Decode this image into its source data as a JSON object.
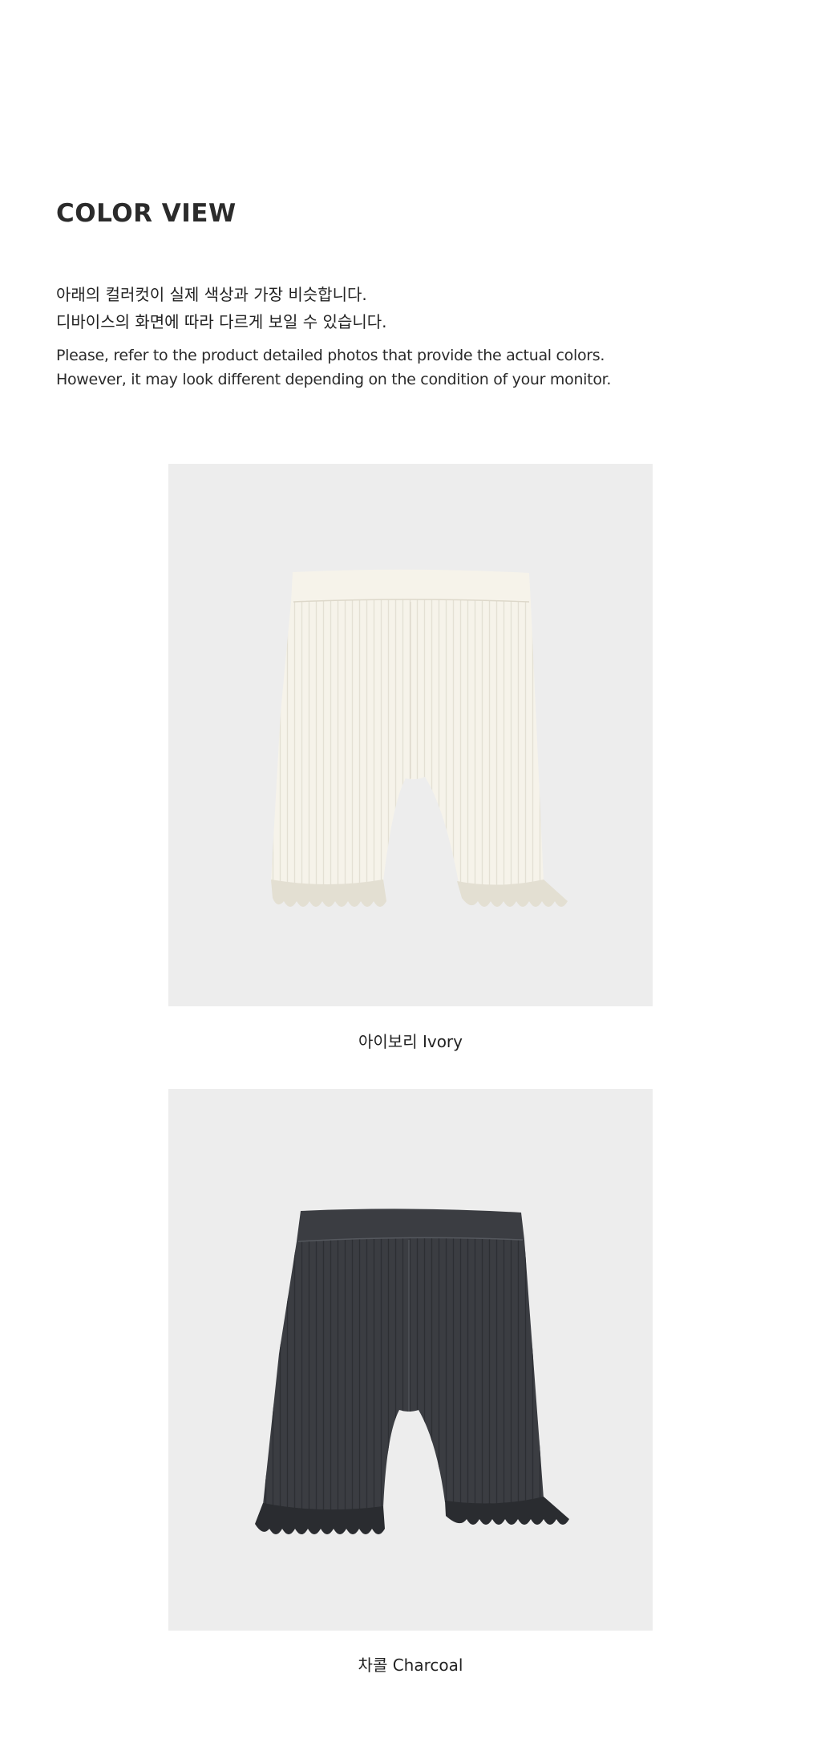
{
  "section": {
    "title": "COLOR VIEW"
  },
  "intro": {
    "ko_lines": [
      "아래의 컬러컷이 실제 색상과 가장 비슷합니다.",
      "디바이스의 화면에 따라 다르게 보일 수 있습니다."
    ],
    "en_lines": [
      "Please, refer to the product detailed photos that provide the actual colors.",
      "However, it may look different depending on the condition of your monitor."
    ]
  },
  "colors": [
    {
      "caption": "아이보리 Ivory",
      "swatch": "#f6f3ea",
      "shade": "#e3dfd2",
      "background": "#ededed"
    },
    {
      "caption": "차콜 Charcoal",
      "swatch": "#3b3d42",
      "shade": "#2a2c30",
      "background": "#ededed"
    }
  ]
}
